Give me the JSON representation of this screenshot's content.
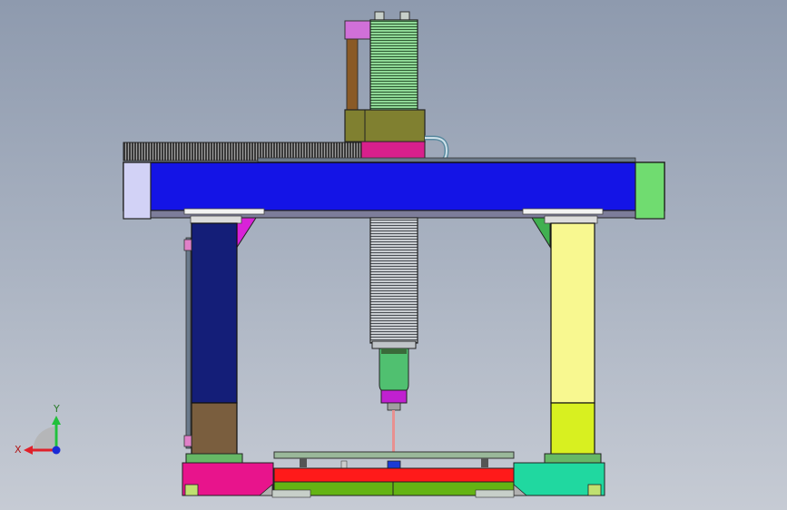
{
  "axis_triad": {
    "x_label": "X",
    "y_label": "Y",
    "x_color": "#e0202a",
    "y_color": "#22c03c",
    "z_color": "#1a2bd6"
  },
  "colors": {
    "background_top": "#8e9aae",
    "background_bottom": "#c3c8d2",
    "beam": "#1414e6",
    "beam_cap_left": "#d2d2f6",
    "beam_cap_right": "#70dc70",
    "column_left": "#141e78",
    "column_left_base": "#7a5e3e",
    "column_right": "#f8f890",
    "column_right_base": "#d8f020",
    "spindle_fins": "#8fd896",
    "spindle_motor": "#808030",
    "spindle_mount": "#d8208c",
    "spindle_nose": "#50c070",
    "tool_holder": "#c020d0",
    "table_top": "#ff1a1a",
    "table_base": "#64b414",
    "foot_left": "#e8148c",
    "foot_right": "#20d8a0",
    "rail": "#555555",
    "bracket": "#d822d8"
  },
  "components": [
    "gantry-beam",
    "left-column",
    "right-column",
    "z-axis-spindle",
    "work-table",
    "base-feet",
    "cable-chain",
    "axis-triad"
  ]
}
